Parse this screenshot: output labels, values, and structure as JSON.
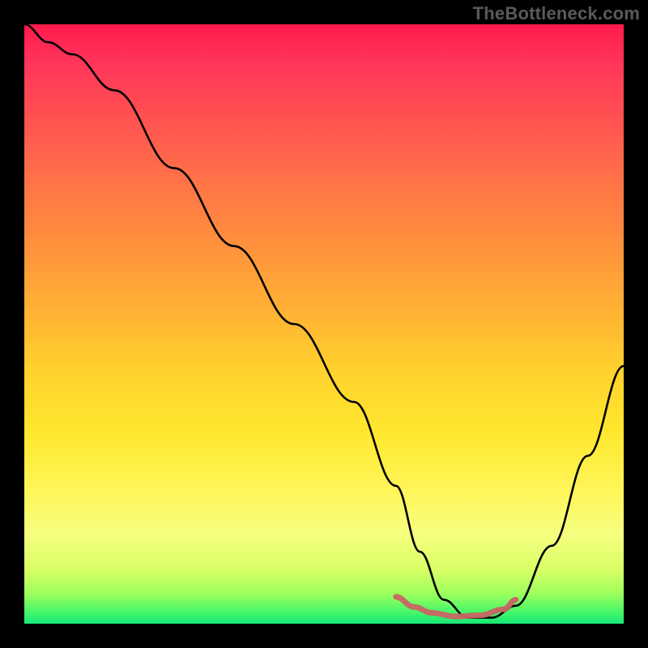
{
  "watermark": "TheBottleneck.com",
  "chart_data": {
    "type": "line",
    "title": "",
    "xlabel": "",
    "ylabel": "",
    "xlim": [
      0,
      100
    ],
    "ylim": [
      0,
      100
    ],
    "background": {
      "type": "vertical-gradient",
      "meaning": "bottleneck severity (top=high, bottom=low)",
      "stops": [
        {
          "pct": 0,
          "color": "#ff1a4b"
        },
        {
          "pct": 15,
          "color": "#ff4f52"
        },
        {
          "pct": 35,
          "color": "#ff8c3e"
        },
        {
          "pct": 58,
          "color": "#ffd22d"
        },
        {
          "pct": 78,
          "color": "#fff65a"
        },
        {
          "pct": 91,
          "color": "#d9ff66"
        },
        {
          "pct": 100,
          "color": "#14e877"
        }
      ]
    },
    "series": [
      {
        "name": "bottleneck-curve",
        "color": "#000000",
        "x": [
          0,
          4,
          8,
          15,
          25,
          35,
          45,
          55,
          62,
          66,
          70,
          74,
          78,
          82,
          88,
          94,
          100
        ],
        "y": [
          100,
          97,
          95,
          89,
          76,
          63,
          50,
          37,
          23,
          12,
          4,
          1,
          1,
          3,
          13,
          28,
          43
        ]
      },
      {
        "name": "optimal-range-marker",
        "color": "#d46a6a",
        "style": "thick",
        "x": [
          62,
          65,
          68,
          72,
          76,
          80,
          82
        ],
        "y": [
          4.5,
          2.8,
          1.8,
          1.2,
          1.4,
          2.4,
          4.0
        ]
      }
    ],
    "annotations": []
  }
}
